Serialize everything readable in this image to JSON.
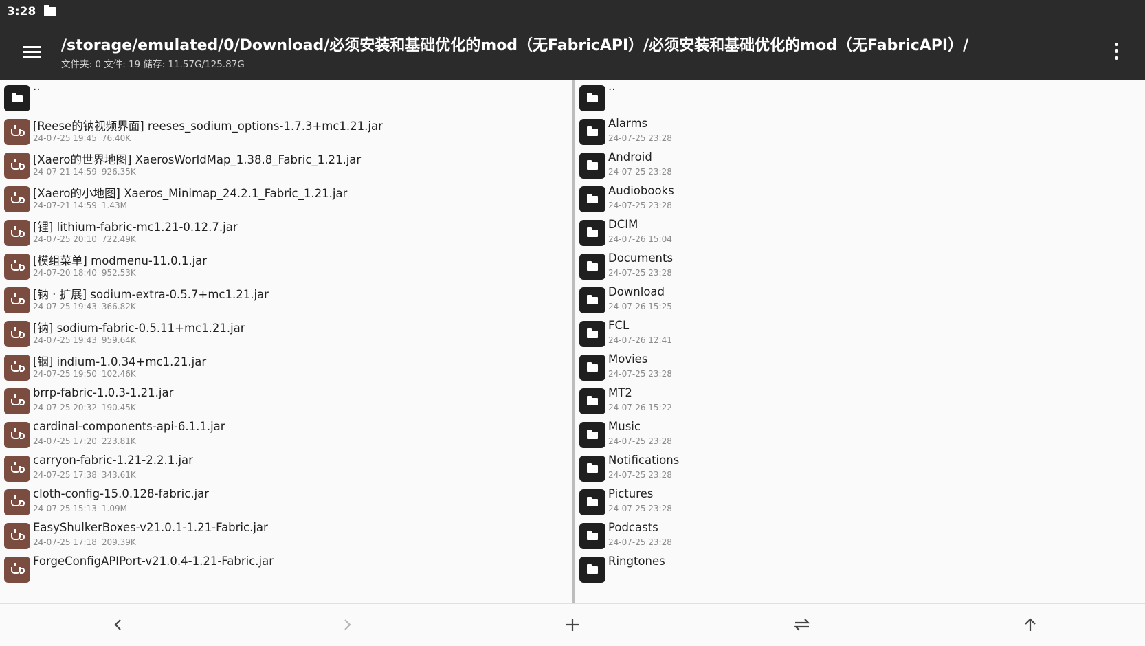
{
  "status_bar": {
    "time": "3:28",
    "notification_icon": "sd-card-icon"
  },
  "app_bar": {
    "path": "/storage/emulated/0/Download/必须安装和基础优化的mod（无FabricAPI）/必须安装和基础优化的mod（无FabricAPI）/",
    "summary": "文件夹: 0  文件: 19  储存: 11.57G/125.87G",
    "menu_icon": "hamburger-menu-icon",
    "more_icon": "more-vert-icon"
  },
  "left_pane": {
    "parent_label": "..",
    "files": [
      {
        "name": "[Reese的钠视频界面] reeses_sodium_options-1.7.3+mc1.21.jar",
        "date": "24-07-25 19:45",
        "size": "76.40K"
      },
      {
        "name": "[Xaero的世界地图] XaerosWorldMap_1.38.8_Fabric_1.21.jar",
        "date": "24-07-21 14:59",
        "size": "926.35K"
      },
      {
        "name": "[Xaero的小地图] Xaeros_Minimap_24.2.1_Fabric_1.21.jar",
        "date": "24-07-21 14:59",
        "size": "1.43M"
      },
      {
        "name": "[锂] lithium-fabric-mc1.21-0.12.7.jar",
        "date": "24-07-25 20:10",
        "size": "722.49K"
      },
      {
        "name": "[模组菜单] modmenu-11.0.1.jar",
        "date": "24-07-20 18:40",
        "size": "952.53K"
      },
      {
        "name": "[钠 · 扩展] sodium-extra-0.5.7+mc1.21.jar",
        "date": "24-07-25 19:43",
        "size": "366.82K"
      },
      {
        "name": "[钠] sodium-fabric-0.5.11+mc1.21.jar",
        "date": "24-07-25 19:43",
        "size": "959.64K"
      },
      {
        "name": "[铟] indium-1.0.34+mc1.21.jar",
        "date": "24-07-25 19:50",
        "size": "102.46K"
      },
      {
        "name": "brrp-fabric-1.0.3-1.21.jar",
        "date": "24-07-25 20:32",
        "size": "190.45K"
      },
      {
        "name": "cardinal-components-api-6.1.1.jar",
        "date": "24-07-25 17:20",
        "size": "223.81K"
      },
      {
        "name": "carryon-fabric-1.21-2.2.1.jar",
        "date": "24-07-25 17:38",
        "size": "343.61K"
      },
      {
        "name": "cloth-config-15.0.128-fabric.jar",
        "date": "24-07-25 15:13",
        "size": "1.09M"
      },
      {
        "name": "EasyShulkerBoxes-v21.0.1-1.21-Fabric.jar",
        "date": "24-07-25 17:18",
        "size": "209.39K"
      },
      {
        "name": "ForgeConfigAPIPort-v21.0.4-1.21-Fabric.jar",
        "date": "",
        "size": ""
      }
    ]
  },
  "right_pane": {
    "parent_label": "..",
    "folders": [
      {
        "name": "Alarms",
        "date": "24-07-25 23:28"
      },
      {
        "name": "Android",
        "date": "24-07-25 23:28"
      },
      {
        "name": "Audiobooks",
        "date": "24-07-25 23:28"
      },
      {
        "name": "DCIM",
        "date": "24-07-26 15:04"
      },
      {
        "name": "Documents",
        "date": "24-07-25 23:28"
      },
      {
        "name": "Download",
        "date": "24-07-26 15:25"
      },
      {
        "name": "FCL",
        "date": "24-07-26 12:41"
      },
      {
        "name": "Movies",
        "date": "24-07-25 23:28"
      },
      {
        "name": "MT2",
        "date": "24-07-26 15:22"
      },
      {
        "name": "Music",
        "date": "24-07-25 23:28"
      },
      {
        "name": "Notifications",
        "date": "24-07-25 23:28"
      },
      {
        "name": "Pictures",
        "date": "24-07-25 23:28"
      },
      {
        "name": "Podcasts",
        "date": "24-07-25 23:28"
      },
      {
        "name": "Ringtones",
        "date": ""
      }
    ]
  },
  "bottom_bar": {
    "buttons": [
      "back-icon",
      "forward-icon",
      "add-icon",
      "swap-icon",
      "up-icon"
    ]
  },
  "colors": {
    "app_bar": "#2b2b2b",
    "folder_icon_bg": "#1f1f1f",
    "jar_icon_bg": "#7b4d41",
    "background": "#fafafa"
  }
}
